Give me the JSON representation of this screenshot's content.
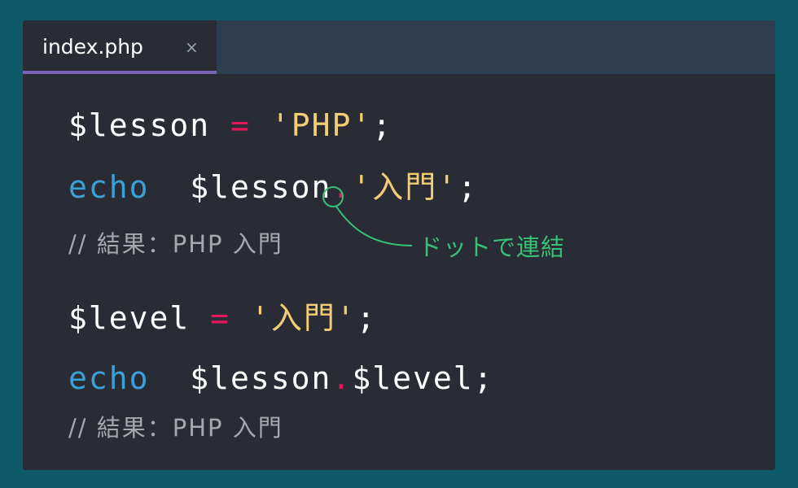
{
  "tab": {
    "title": "index.php",
    "close_glyph": "×"
  },
  "colors": {
    "background": "#0d5b68",
    "editor_bg": "#292c34",
    "tabbar_bg": "#2e3e51",
    "tab_underline": "#7a63b8",
    "keyword": "#3aa1d8",
    "operator": "#e3175a",
    "string": "#f1ce74",
    "comment": "#a5a9af",
    "annotation": "#37c178"
  },
  "code": {
    "line1": {
      "var": "$lesson",
      "op": "=",
      "str": "'PHP'",
      "end": ";"
    },
    "line2": {
      "kw": "echo",
      "var": "$lesson",
      "op": ".",
      "str": "'入門'",
      "end": ";"
    },
    "comment1": "// 結果：PHP 入門",
    "line3": {
      "var": "$level",
      "op": "=",
      "str": "'入門'",
      "end": ";"
    },
    "line4": {
      "kw": "echo",
      "var1": "$lesson",
      "op": ".",
      "var2": "$level",
      "end": ";"
    },
    "comment2": "// 結果：PHP 入門"
  },
  "annotation": {
    "label": "ドットで連結",
    "icon": "circle-callout"
  }
}
